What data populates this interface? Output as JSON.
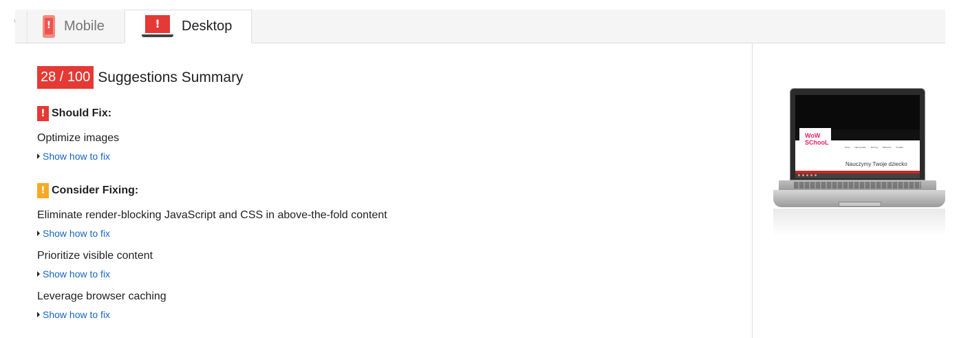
{
  "tabs": [
    {
      "label": "Mobile",
      "icon": "mobile-warning-icon"
    },
    {
      "label": "Desktop",
      "icon": "desktop-warning-icon",
      "active": true
    }
  ],
  "summary": {
    "score": "28 / 100",
    "title": "Suggestions Summary"
  },
  "should_fix": {
    "label": "Should Fix:",
    "badge": "!",
    "rules": [
      {
        "title": "Optimize images",
        "link": "Show how to fix"
      }
    ]
  },
  "consider_fixing": {
    "label": "Consider Fixing:",
    "badge": "!",
    "rules": [
      {
        "title": "Eliminate render-blocking JavaScript and CSS in above-the-fold content",
        "link": "Show how to fix"
      },
      {
        "title": "Prioritize visible content",
        "link": "Show how to fix"
      },
      {
        "title": "Leverage browser caching",
        "link": "Show how to fix"
      }
    ]
  },
  "preview": {
    "logo_text": "WoW SChooL",
    "slogan": "Nauczymy Twoje dziecko",
    "menu": "Kursy Nauczyciele Terminy Partnerzy Kontakt"
  },
  "colors": {
    "score_red": "#e53935",
    "warning_orange": "#f9a825",
    "link_blue": "#1565c0"
  }
}
